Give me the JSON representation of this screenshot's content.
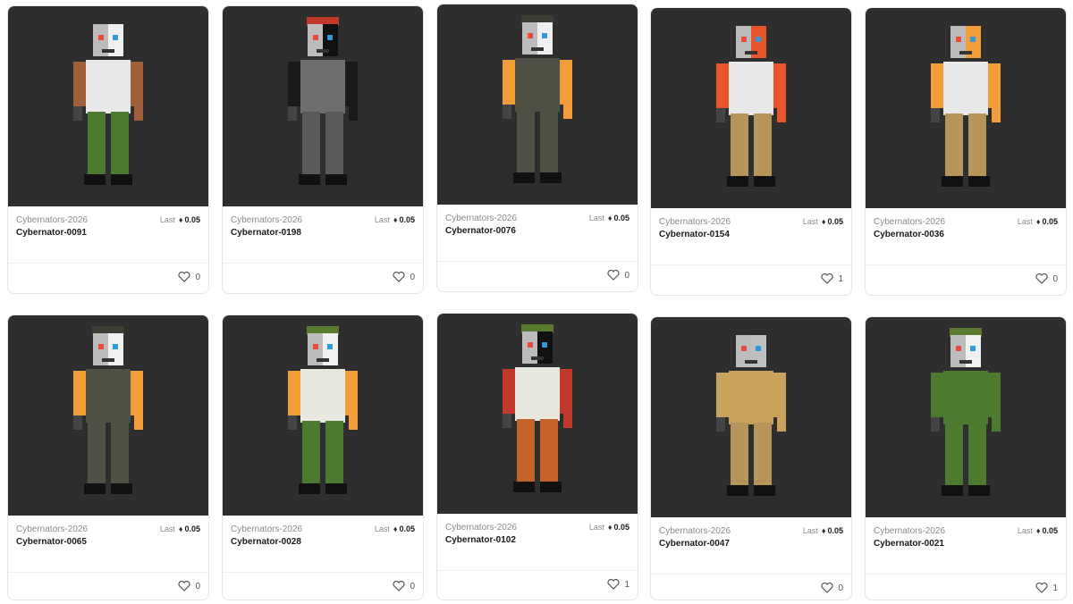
{
  "colors": {
    "card_bg": "#2e2e2e",
    "accent": "#1a1a1a"
  },
  "cards": [
    {
      "collection": "Cybernators-2026",
      "name": "Cybernator-0091",
      "price_label": "Last",
      "price": "0.05",
      "likes": "0",
      "fur": "#a0613a",
      "top": "#e8e8e8",
      "pants": "#4c7a2e",
      "head": "#f0f0f0",
      "hat": ""
    },
    {
      "collection": "Cybernators-2026",
      "name": "Cybernator-0198",
      "price_label": "Last",
      "price": "0.05",
      "likes": "0",
      "fur": "#1a1a1a",
      "top": "#6e6e6e",
      "pants": "#5a5a5a",
      "head": "#111111",
      "hat": "#c0392b"
    },
    {
      "collection": "Cybernators-2026",
      "name": "Cybernator-0076",
      "price_label": "Last",
      "price": "0.05",
      "likes": "0",
      "fur": "#f39c3c",
      "top": "#4d5245",
      "pants": "#4d5245",
      "head": "#f0f0f0",
      "hat": "#3d3d33"
    },
    {
      "collection": "Cybernators-2026",
      "name": "Cybernator-0154",
      "price_label": "Last",
      "price": "0.05",
      "likes": "1",
      "fur": "#e8552b",
      "top": "#e8e8e8",
      "pants": "#b7955a",
      "head": "#e8552b",
      "hat": ""
    },
    {
      "collection": "Cybernators-2026",
      "name": "Cybernator-0036",
      "price_label": "Last",
      "price": "0.05",
      "likes": "0",
      "fur": "#f39c3c",
      "top": "#e8e8e8",
      "pants": "#b7955a",
      "head": "#f39c3c",
      "hat": ""
    },
    {
      "collection": "Cybernators-2026",
      "name": "Cybernator-0065",
      "price_label": "Last",
      "price": "0.05",
      "likes": "0",
      "fur": "#f39c3c",
      "top": "#4d5245",
      "pants": "#4d5245",
      "head": "#f0f0f0",
      "hat": "#3d3d33"
    },
    {
      "collection": "Cybernators-2026",
      "name": "Cybernator-0028",
      "price_label": "Last",
      "price": "0.05",
      "likes": "0",
      "fur": "#f39c3c",
      "top": "#e8e8e0",
      "pants": "#4c7a2e",
      "head": "#f0f0f0",
      "hat": "#5a7a30"
    },
    {
      "collection": "Cybernators-2026",
      "name": "Cybernator-0102",
      "price_label": "Last",
      "price": "0.05",
      "likes": "1",
      "fur": "#c0392b",
      "top": "#e8e8e0",
      "pants": "#c4622a",
      "head": "#111111",
      "hat": "#5a7a30"
    },
    {
      "collection": "Cybernators-2026",
      "name": "Cybernator-0047",
      "price_label": "Last",
      "price": "0.05",
      "likes": "0",
      "fur": "#c9a25c",
      "top": "#c9a25c",
      "pants": "#b7955a",
      "head": "#bfbfbf",
      "hat": ""
    },
    {
      "collection": "Cybernators-2026",
      "name": "Cybernator-0021",
      "price_label": "Last",
      "price": "0.05",
      "likes": "1",
      "fur": "#4c7a2e",
      "top": "#4c7a2e",
      "pants": "#4c7a2e",
      "head": "#f0f0f0",
      "hat": "#5a7a30"
    }
  ]
}
